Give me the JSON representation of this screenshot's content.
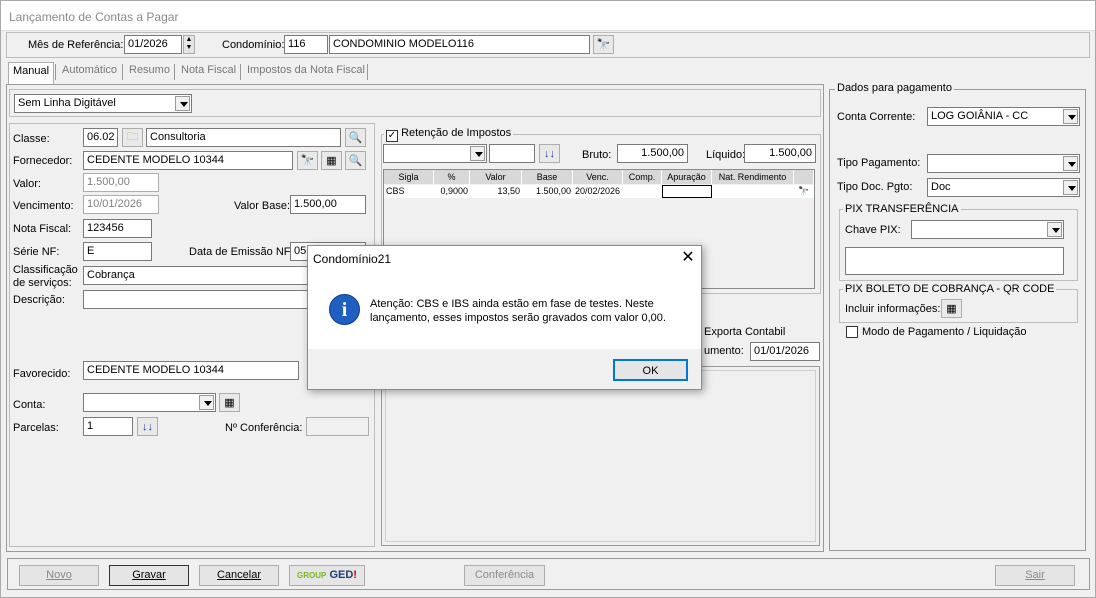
{
  "window": {
    "title": "Lançamento de Contas a Pagar"
  },
  "header": {
    "mes_label": "Mês de Referência:",
    "mes_value": "01/2026",
    "condominio_label": "Condomínio:",
    "condominio_code": "116",
    "condominio_name": "CONDOMINIO MODELO116"
  },
  "tabs": [
    {
      "label": "Manual"
    },
    {
      "label": "Automático"
    },
    {
      "label": "Resumo"
    },
    {
      "label": "Nota Fiscal"
    },
    {
      "label": "Impostos da Nota Fiscal"
    }
  ],
  "linha_digitavel": {
    "value": "Sem Linha Digitável"
  },
  "form": {
    "classe_label": "Classe:",
    "classe_code": "06.02",
    "classe_name": "Consultoria",
    "fornecedor_label": "Fornecedor:",
    "fornecedor_value": "CEDENTE MODELO 10344",
    "valor_label": "Valor:",
    "valor_value": "1.500,00",
    "vencimento_label": "Vencimento:",
    "vencimento_value": "10/01/2026",
    "valor_base_label": "Valor Base:",
    "valor_base_value": "1.500,00",
    "nota_fiscal_label": "Nota Fiscal:",
    "nota_fiscal_value": "123456",
    "serie_nf_label": "Série NF:",
    "serie_nf_value": "E",
    "data_emissao_label": "Data de Emissão NF:",
    "data_emissao_value": "05",
    "classificacao_label_1": "Classificação",
    "classificacao_label_2": "de serviços:",
    "classificacao_value": "Cobrança",
    "descricao_label": "Descrição:",
    "favorecido_label": "Favorecido:",
    "favorecido_value": "CEDENTE MODELO 10344",
    "conta_label": "Conta:",
    "parcelas_label": "Parcelas:",
    "parcelas_value": "1",
    "conferencia_label": "Nº Conferência:"
  },
  "impostos": {
    "checkbox_label": "Retenção de Impostos",
    "checked": true,
    "bruto_label": "Bruto:",
    "bruto_value": "1.500,00",
    "liquido_label": "Líquido:",
    "liquido_value": "1.500,00",
    "columns": [
      "Sigla",
      "%",
      "Valor",
      "Base",
      "Venc.",
      "Comp.",
      "Apuração",
      "Nat. Rendimento"
    ],
    "rows": [
      {
        "sigla": "CBS",
        "pct": "0,9000",
        "valor": "13,50",
        "base": "1.500,00",
        "venc": "20/02/2026",
        "comp": "",
        "apuracao": "",
        "nat": ""
      }
    ]
  },
  "middle": {
    "exporta_label": "Exporta Contabil",
    "documento_label": "umento:",
    "documento_value": "01/01/2026"
  },
  "pagamento": {
    "group_title": "Dados para pagamento",
    "conta_corrente_label": "Conta Corrente:",
    "conta_corrente_value": "LOG GOIÂNIA - CC",
    "tipo_pagamento_label": "Tipo Pagamento:",
    "tipo_doc_label": "Tipo Doc. Pgto:",
    "tipo_doc_value": "Doc",
    "pix_title": "PIX TRANSFERÊNCIA",
    "chave_pix_label": "Chave PIX:",
    "boleto_title": "PIX BOLETO DE COBRANÇA - QR CODE",
    "incluir_label": "Incluir informações:",
    "modo_label": "Modo de Pagamento / Liquidação"
  },
  "footer": {
    "novo": "Novo",
    "gravar": "Gravar",
    "cancelar": "Cancelar",
    "ged_group": "GROUP",
    "ged_text": "GED",
    "conferencia": "Conferência",
    "sair": "Sair"
  },
  "dialog": {
    "title": "Condomínio21",
    "message_1": "Atenção: CBS e IBS ainda estão em fase de testes. Neste",
    "message_2": "lançamento, esses impostos serão gravados com valor 0,00.",
    "ok": "OK"
  }
}
